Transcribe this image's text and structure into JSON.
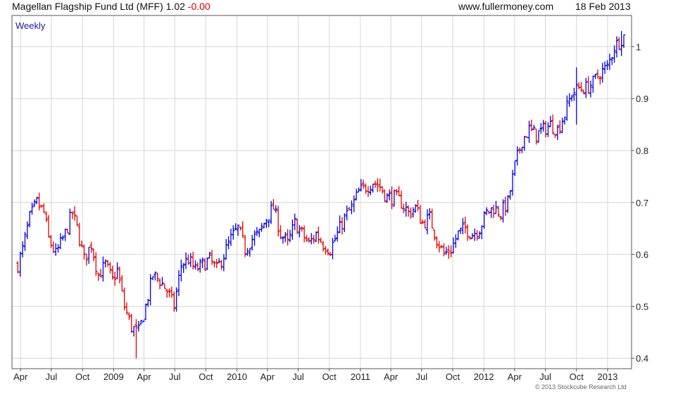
{
  "header": {
    "title": "Magellan Flagship Fund Ltd (MFF) 1.02",
    "change": "-0.00",
    "website": "www.fullermoney.com",
    "date": "18 Feb 2013"
  },
  "copyright": "© 2013 Stockcube Research Ltd",
  "colors": {
    "up": "#0000e0",
    "down": "#e00000",
    "grid": "#d6d6d6",
    "axis": "#555555",
    "period_label": "#1a1aa6"
  },
  "chart_data": {
    "type": "ohlc",
    "period_label": "Weekly",
    "x_tick_labels": [
      "Apr",
      "Jul",
      "Oct",
      "2009",
      "Apr",
      "Jul",
      "Oct",
      "2010",
      "Apr",
      "Jul",
      "Oct",
      "2011",
      "Apr",
      "Jul",
      "Oct",
      "2012",
      "Apr",
      "Jul",
      "Oct",
      "2013"
    ],
    "y_axis": {
      "position": "right",
      "ticks": [
        0.4,
        0.5,
        0.6,
        0.7,
        0.8,
        0.9,
        1
      ],
      "tick_labels": [
        "0.4",
        "0.5",
        "0.6",
        "0.7",
        "0.8",
        "0.9",
        "1"
      ],
      "range": [
        0.38,
        1.06
      ]
    },
    "grid": true,
    "x_range": [
      "2008-03-17",
      "2013-02-18"
    ],
    "anchors": [
      [
        "2008-03-24",
        0.58
      ],
      [
        "2008-04-07",
        0.61
      ],
      [
        "2008-04-28",
        0.67
      ],
      [
        "2008-05-19",
        0.7
      ],
      [
        "2008-06-09",
        0.68
      ],
      [
        "2008-06-23",
        0.63
      ],
      [
        "2008-07-14",
        0.6
      ],
      [
        "2008-08-11",
        0.64
      ],
      [
        "2008-09-01",
        0.68
      ],
      [
        "2008-09-15",
        0.65
      ],
      [
        "2008-10-06",
        0.59
      ],
      [
        "2008-10-27",
        0.62
      ],
      [
        "2008-11-17",
        0.56
      ],
      [
        "2008-12-08",
        0.58
      ],
      [
        "2008-12-29",
        0.55
      ],
      [
        "2009-01-12",
        0.57
      ],
      [
        "2009-02-02",
        0.5
      ],
      [
        "2009-02-23",
        0.46
      ],
      [
        "2009-03-16",
        0.45
      ],
      [
        "2009-04-06",
        0.5
      ],
      [
        "2009-04-27",
        0.56
      ],
      [
        "2009-05-18",
        0.55
      ],
      [
        "2009-06-08",
        0.53
      ],
      [
        "2009-06-29",
        0.5
      ],
      [
        "2009-07-20",
        0.58
      ],
      [
        "2009-08-10",
        0.59
      ],
      [
        "2009-08-31",
        0.57
      ],
      [
        "2009-09-21",
        0.58
      ],
      [
        "2009-10-12",
        0.59
      ],
      [
        "2009-11-02",
        0.57
      ],
      [
        "2009-11-23",
        0.6
      ],
      [
        "2009-12-14",
        0.63
      ],
      [
        "2010-01-04",
        0.65
      ],
      [
        "2010-01-25",
        0.61
      ],
      [
        "2010-02-15",
        0.63
      ],
      [
        "2010-03-08",
        0.64
      ],
      [
        "2010-03-29",
        0.67
      ],
      [
        "2010-04-19",
        0.69
      ],
      [
        "2010-05-10",
        0.64
      ],
      [
        "2010-05-31",
        0.62
      ],
      [
        "2010-06-21",
        0.66
      ],
      [
        "2010-07-12",
        0.64
      ],
      [
        "2010-08-02",
        0.62
      ],
      [
        "2010-08-23",
        0.64
      ],
      [
        "2010-09-13",
        0.62
      ],
      [
        "2010-10-04",
        0.61
      ],
      [
        "2010-10-25",
        0.64
      ],
      [
        "2010-11-15",
        0.67
      ],
      [
        "2010-12-06",
        0.69
      ],
      [
        "2010-12-27",
        0.72
      ],
      [
        "2011-01-17",
        0.73
      ],
      [
        "2011-02-07",
        0.74
      ],
      [
        "2011-02-28",
        0.73
      ],
      [
        "2011-03-21",
        0.71
      ],
      [
        "2011-04-11",
        0.71
      ],
      [
        "2011-05-02",
        0.7
      ],
      [
        "2011-05-23",
        0.68
      ],
      [
        "2011-06-13",
        0.69
      ],
      [
        "2011-07-04",
        0.66
      ],
      [
        "2011-07-25",
        0.67
      ],
      [
        "2011-08-15",
        0.63
      ],
      [
        "2011-09-05",
        0.6
      ],
      [
        "2011-09-26",
        0.61
      ],
      [
        "2011-10-17",
        0.64
      ],
      [
        "2011-11-07",
        0.65
      ],
      [
        "2011-11-28",
        0.64
      ],
      [
        "2011-12-19",
        0.65
      ],
      [
        "2012-01-09",
        0.68
      ],
      [
        "2012-01-30",
        0.69
      ],
      [
        "2012-02-20",
        0.68
      ],
      [
        "2012-03-12",
        0.7
      ],
      [
        "2012-04-02",
        0.77
      ],
      [
        "2012-04-23",
        0.82
      ],
      [
        "2012-05-14",
        0.84
      ],
      [
        "2012-06-04",
        0.83
      ],
      [
        "2012-06-25",
        0.84
      ],
      [
        "2012-07-16",
        0.85
      ],
      [
        "2012-08-06",
        0.84
      ],
      [
        "2012-08-27",
        0.87
      ],
      [
        "2012-09-17",
        0.91
      ],
      [
        "2012-10-08",
        0.92
      ],
      [
        "2012-10-29",
        0.92
      ],
      [
        "2012-11-19",
        0.93
      ],
      [
        "2012-12-10",
        0.95
      ],
      [
        "2012-12-31",
        0.96
      ],
      [
        "2013-01-21",
        1.0
      ],
      [
        "2013-02-04",
        1.01
      ],
      [
        "2013-02-18",
        1.02
      ]
    ],
    "notable_wicks": [
      {
        "date": "2009-03-09",
        "low": 0.4
      },
      {
        "date": "2012-10-01",
        "low": 0.85,
        "high": 0.96
      },
      {
        "date": "2013-02-11",
        "high": 1.03
      }
    ]
  }
}
